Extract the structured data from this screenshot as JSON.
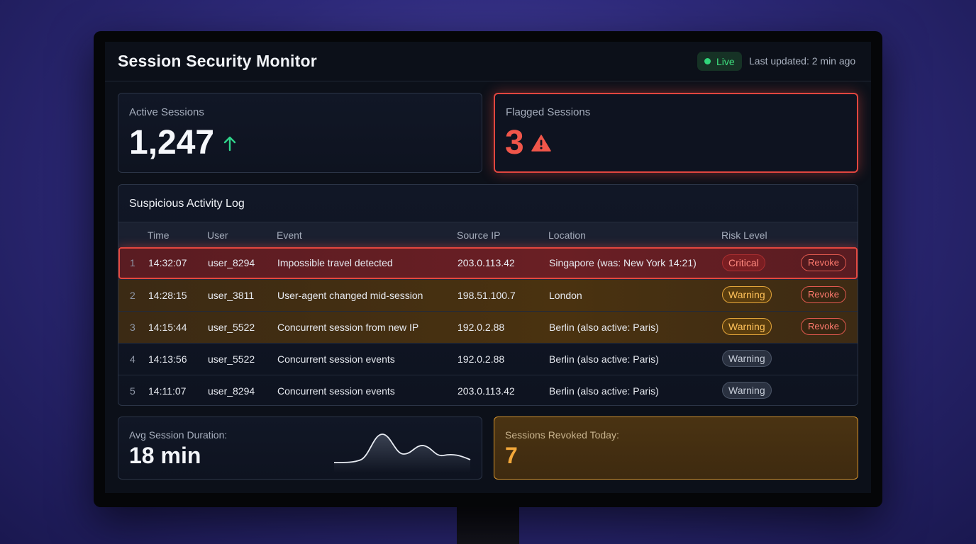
{
  "header": {
    "title": "Session Security Monitor",
    "live_label": "Live",
    "updated_label": "Last updated: 2 min ago"
  },
  "active_sessions": {
    "label": "Active Sessions",
    "value": "1,247",
    "trend_icon": "arrow-up-icon"
  },
  "flagged_sessions": {
    "label": "Flagged Sessions",
    "value": "3",
    "icon": "warning-triangle-icon"
  },
  "log": {
    "title": "Suspicious Activity Log",
    "columns": [
      "Time",
      "User",
      "Event",
      "Source IP",
      "Location",
      "Risk Level"
    ],
    "revoke_label": "Revoke",
    "rows": [
      {
        "n": "1",
        "time": "14:32:07",
        "user": "user_8294",
        "event": "Impossible travel detected",
        "ip": "203.0.113.42",
        "location": "Singapore (was: New York 14:21)",
        "risk": "Critical"
      },
      {
        "n": "2",
        "time": "14:28:15",
        "user": "user_3811",
        "event": "User-agent changed mid-session",
        "ip": "198.51.100.7",
        "location": "London",
        "risk": "Warning"
      },
      {
        "n": "3",
        "time": "14:15:44",
        "user": "user_5522",
        "event": "Concurrent session from new IP",
        "ip": "192.0.2.88",
        "location": "Berlin (also active: Paris)",
        "risk": "Warning"
      },
      {
        "n": "4",
        "time": "14:13:56",
        "user": "user_5522",
        "event": "Concurrent session events",
        "ip": "192.0.2.88",
        "location": "Berlin (also active: Paris)",
        "risk": "Warning"
      },
      {
        "n": "5",
        "time": "14:11:07",
        "user": "user_8294",
        "event": "Concurrent session events",
        "ip": "203.0.113.42",
        "location": "Berlin (also active: Paris)",
        "risk": "Warning"
      }
    ]
  },
  "avg_duration": {
    "label": "Avg Session Duration:",
    "value": "18 min"
  },
  "revoked_today": {
    "label": "Sessions Revoked Today:",
    "value": "7"
  },
  "colors": {
    "critical": "#e5473f",
    "warning": "#e2a43a",
    "live": "#30d67a",
    "accent_up": "#2fd38a"
  }
}
